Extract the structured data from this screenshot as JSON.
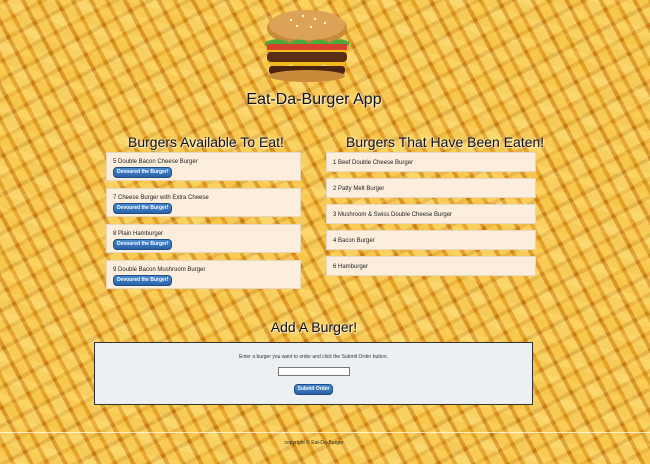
{
  "header": {
    "app_title": "Eat-Da-Burger App",
    "logo_icon": "burger-icon"
  },
  "available": {
    "title": "Burgers Available To Eat!",
    "items": [
      {
        "label": "5 Double Bacon Cheese Burger",
        "button": "Devoured the Burger!"
      },
      {
        "label": "7 Cheese Burger with Extra Cheese",
        "button": "Devoured the Burger!"
      },
      {
        "label": "8 Plain Hamburger",
        "button": "Devoured the Burger!"
      },
      {
        "label": "9 Double Bacon Mushroom Burger",
        "button": "Devoured the Burger!"
      }
    ]
  },
  "eaten": {
    "title": "Burgers That Have Been Eaten!",
    "items": [
      {
        "label": "1 Beef Double Cheese Burger"
      },
      {
        "label": "2 Patty Melt Burger"
      },
      {
        "label": "3 Mushroom & Swiss Double Cheese Burger"
      },
      {
        "label": "4 Bacon Burger"
      },
      {
        "label": "6 Hamburger"
      }
    ]
  },
  "add": {
    "title": "Add A Burger!",
    "instructions": "Enter a burger you want to order and click the Submit Order button.",
    "input_value": "",
    "submit_label": "Submit Order"
  },
  "footer": {
    "copyright": "copyright © Eat-Da-Burger"
  },
  "colors": {
    "card_bg": "#fbeedd",
    "button_blue": "#2a63a8",
    "panel_bg": "#edf0f3"
  }
}
